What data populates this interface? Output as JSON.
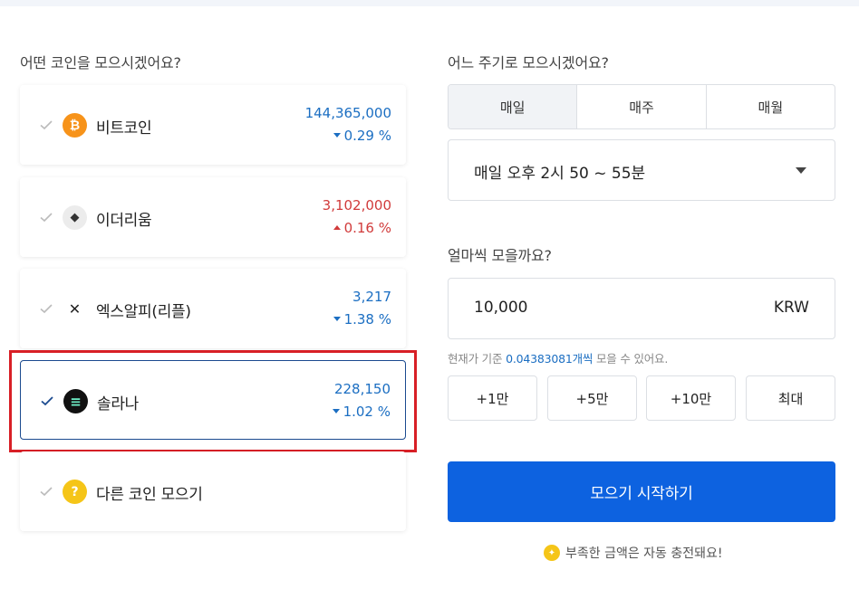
{
  "left": {
    "title": "어떤 코인을 모으시겠어요?",
    "coins": [
      {
        "name": "비트코인",
        "price": "144,365,000",
        "change": "0.29 %",
        "direction": "down",
        "icon": "bitcoin-icon",
        "icon_glyph": "₿",
        "icon_bg": "#f7931a",
        "selected": false
      },
      {
        "name": "이더리움",
        "price": "3,102,000",
        "change": "0.16 %",
        "direction": "up",
        "icon": "ethereum-icon",
        "icon_glyph": "◆",
        "icon_bg": "#ececec",
        "selected": false
      },
      {
        "name": "엑스알피(리플)",
        "price": "3,217",
        "change": "1.38 %",
        "direction": "down",
        "icon": "xrp-icon",
        "icon_glyph": "✕",
        "icon_bg": "#ffffff",
        "selected": false
      },
      {
        "name": "솔라나",
        "price": "228,150",
        "change": "1.02 %",
        "direction": "down",
        "icon": "solana-icon",
        "icon_glyph": "≡",
        "icon_bg": "#111111",
        "selected": true
      }
    ],
    "other": {
      "name": "다른 코인 모으기",
      "icon": "question-icon",
      "icon_glyph": "?"
    }
  },
  "right": {
    "period_title": "어느 주기로 모으시겠어요?",
    "period_tabs": [
      "매일",
      "매주",
      "매월"
    ],
    "period_active": 0,
    "time_value": "매일 오후 2시 50 ~ 55분",
    "amount_title": "얼마씩 모을까요?",
    "amount_value": "10,000",
    "amount_unit": "KRW",
    "hint_prefix": "현재가 기준",
    "hint_amount": "0.04383081개씩",
    "hint_suffix": "모을 수 있어요.",
    "quick_buttons": [
      "+1만",
      "+5만",
      "+10만",
      "최대"
    ],
    "start_label": "모으기 시작하기",
    "auto_note": "부족한 금액은 자동 충전돼요!"
  },
  "colors": {
    "accent": "#0d62e0",
    "price_down": "#1b6ec2",
    "price_up": "#d13b3b",
    "highlight": "#d81f26"
  }
}
